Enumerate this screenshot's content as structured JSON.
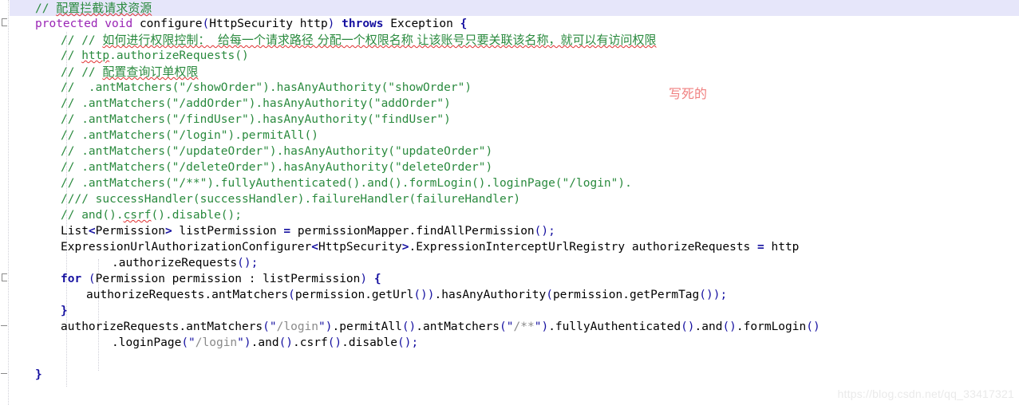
{
  "app": {
    "kind": "code-editor",
    "language": "Java",
    "theme": "light"
  },
  "colors": {
    "background": "#ffffff",
    "comment": "#2a8a3e",
    "keyword_purple": "#9a25b5",
    "keyword_blue": "#1510a0",
    "string": "#8a8a8a",
    "punctuation": "#1510a0",
    "current_line_highlight": "#e6e6fa",
    "spellcheck_squiggle": "#e03030",
    "annotation_red": "#f08080",
    "watermark": "#eaeaea",
    "indent_guide": "#cfcfd8",
    "fold_marker": "#8a8a8a"
  },
  "gutter": {
    "fold_markers": [
      {
        "line": 2,
        "type": "fold-end-bracket"
      },
      {
        "line": 18,
        "type": "fold-end-bracket"
      },
      {
        "line": 21,
        "type": "dash"
      },
      {
        "line": 24,
        "type": "dash"
      }
    ]
  },
  "annotation": {
    "text": "写死的",
    "meaning": "hard-coded"
  },
  "watermark": {
    "text": "https://blog.csdn.net/qq_33417321"
  },
  "code": {
    "line_height_px": 20,
    "current_line": 1,
    "lines": [
      {
        "n": 1,
        "indent": 4,
        "tokens": [
          {
            "t": "// ",
            "c": "cm"
          },
          {
            "t": "配置拦截请求资源",
            "c": "cm sq cjk"
          }
        ]
      },
      {
        "n": 2,
        "indent": 4,
        "tokens": [
          {
            "t": "protected void ",
            "c": "kw"
          },
          {
            "t": "configure",
            "c": "id"
          },
          {
            "t": "(",
            "c": "pl"
          },
          {
            "t": "HttpSecurity http",
            "c": "id"
          },
          {
            "t": ")",
            "c": "pl"
          },
          {
            "t": " throws ",
            "c": "kwb"
          },
          {
            "t": "Exception ",
            "c": "id"
          },
          {
            "t": "{",
            "c": "pun"
          }
        ]
      },
      {
        "n": 3,
        "indent": 8,
        "tokens": [
          {
            "t": "// // ",
            "c": "cm"
          },
          {
            "t": "如何进行权限控制：  给每一个请求路径 分配一个权限名称 让该账号只要关联该名称，就可以有访问权限",
            "c": "cm sq cjk"
          }
        ]
      },
      {
        "n": 4,
        "indent": 8,
        "tokens": [
          {
            "t": "// ",
            "c": "cm"
          },
          {
            "t": "http",
            "c": "cm sq"
          },
          {
            "t": ".authorizeRequests()",
            "c": "cm"
          }
        ]
      },
      {
        "n": 5,
        "indent": 8,
        "tokens": [
          {
            "t": "// // ",
            "c": "cm"
          },
          {
            "t": "配置查询订单权限",
            "c": "cm sq cjk"
          }
        ]
      },
      {
        "n": 6,
        "indent": 8,
        "tokens": [
          {
            "t": "//  .antMatchers(\"/showOrder\").hasAnyAuthority(\"showOrder\")",
            "c": "cm"
          }
        ]
      },
      {
        "n": 7,
        "indent": 8,
        "tokens": [
          {
            "t": "// .antMatchers(\"/addOrder\").hasAnyAuthority(\"addOrder\")",
            "c": "cm"
          }
        ]
      },
      {
        "n": 8,
        "indent": 8,
        "tokens": [
          {
            "t": "// .antMatchers(\"/findUser\").hasAnyAuthority(\"findUser\")",
            "c": "cm"
          }
        ]
      },
      {
        "n": 9,
        "indent": 8,
        "tokens": [
          {
            "t": "// .antMatchers(\"/login\").permitAll()",
            "c": "cm"
          }
        ]
      },
      {
        "n": 10,
        "indent": 8,
        "tokens": [
          {
            "t": "// .antMatchers(\"/updateOrder\").hasAnyAuthority(\"updateOrder\")",
            "c": "cm"
          }
        ]
      },
      {
        "n": 11,
        "indent": 8,
        "tokens": [
          {
            "t": "// .antMatchers(\"/deleteOrder\").hasAnyAuthority(\"deleteOrder\")",
            "c": "cm"
          }
        ]
      },
      {
        "n": 12,
        "indent": 8,
        "tokens": [
          {
            "t": "// .antMatchers(\"/**\").fullyAuthenticated().and().formLogin().loginPage(\"/login\").",
            "c": "cm"
          }
        ]
      },
      {
        "n": 13,
        "indent": 8,
        "tokens": [
          {
            "t": "//// successHandler(successHandler).failureHandler(failureHandler)",
            "c": "cm"
          }
        ]
      },
      {
        "n": 14,
        "indent": 8,
        "tokens": [
          {
            "t": "// and().",
            "c": "cm"
          },
          {
            "t": "csrf",
            "c": "cm sq"
          },
          {
            "t": "().disable();",
            "c": "cm"
          }
        ]
      },
      {
        "n": 15,
        "indent": 8,
        "tokens": [
          {
            "t": "List",
            "c": "id"
          },
          {
            "t": "<",
            "c": "op"
          },
          {
            "t": "Permission",
            "c": "id"
          },
          {
            "t": ">",
            "c": "op"
          },
          {
            "t": " listPermission ",
            "c": "id"
          },
          {
            "t": "=",
            "c": "op"
          },
          {
            "t": " permissionMapper.findAllPermission",
            "c": "id"
          },
          {
            "t": "()",
            "c": "pl"
          },
          {
            "t": ";",
            "c": "pl"
          }
        ]
      },
      {
        "n": 16,
        "indent": 8,
        "tokens": [
          {
            "t": "ExpressionUrlAuthorizationConfigurer",
            "c": "id"
          },
          {
            "t": "<",
            "c": "op"
          },
          {
            "t": "HttpSecurity",
            "c": "id"
          },
          {
            "t": ">",
            "c": "op"
          },
          {
            "t": ".ExpressionInterceptUrlRegistry authorizeRequests ",
            "c": "id"
          },
          {
            "t": "=",
            "c": "op"
          },
          {
            "t": " http",
            "c": "id"
          }
        ]
      },
      {
        "n": 17,
        "indent": 16,
        "tokens": [
          {
            "t": ".authorizeRequests",
            "c": "id"
          },
          {
            "t": "()",
            "c": "pl"
          },
          {
            "t": ";",
            "c": "pl"
          }
        ]
      },
      {
        "n": 18,
        "indent": 8,
        "tokens": [
          {
            "t": "for ",
            "c": "kwb"
          },
          {
            "t": "(",
            "c": "pl"
          },
          {
            "t": "Permission permission : listPermission",
            "c": "id"
          },
          {
            "t": ")",
            "c": "pl"
          },
          {
            "t": " ",
            "c": "id"
          },
          {
            "t": "{",
            "c": "pun"
          }
        ]
      },
      {
        "n": 19,
        "indent": 12,
        "tokens": [
          {
            "t": "authorizeRequests.antMatchers",
            "c": "id"
          },
          {
            "t": "(",
            "c": "pl"
          },
          {
            "t": "permission.getUrl",
            "c": "id"
          },
          {
            "t": "())",
            "c": "pl"
          },
          {
            "t": ".hasAnyAuthority",
            "c": "id"
          },
          {
            "t": "(",
            "c": "pl"
          },
          {
            "t": "permission.getPermTag",
            "c": "id"
          },
          {
            "t": "())",
            "c": "pl"
          },
          {
            "t": ";",
            "c": "pl"
          }
        ]
      },
      {
        "n": 20,
        "indent": 8,
        "tokens": [
          {
            "t": "}",
            "c": "pun"
          }
        ]
      },
      {
        "n": 21,
        "indent": 8,
        "tokens": [
          {
            "t": "authorizeRequests.antMatchers",
            "c": "id"
          },
          {
            "t": "(",
            "c": "pl"
          },
          {
            "t": "\"",
            "c": "strq"
          },
          {
            "t": "/login",
            "c": "str"
          },
          {
            "t": "\"",
            "c": "strq"
          },
          {
            "t": ")",
            "c": "pl"
          },
          {
            "t": ".permitAll",
            "c": "id"
          },
          {
            "t": "()",
            "c": "pl"
          },
          {
            "t": ".antMatchers",
            "c": "id"
          },
          {
            "t": "(",
            "c": "pl"
          },
          {
            "t": "\"",
            "c": "strq"
          },
          {
            "t": "/**",
            "c": "str"
          },
          {
            "t": "\"",
            "c": "strq"
          },
          {
            "t": ")",
            "c": "pl"
          },
          {
            "t": ".fullyAuthenticated",
            "c": "id"
          },
          {
            "t": "()",
            "c": "pl"
          },
          {
            "t": ".and",
            "c": "id"
          },
          {
            "t": "()",
            "c": "pl"
          },
          {
            "t": ".formLogin",
            "c": "id"
          },
          {
            "t": "()",
            "c": "pl"
          }
        ]
      },
      {
        "n": 22,
        "indent": 16,
        "tokens": [
          {
            "t": ".loginPage",
            "c": "id"
          },
          {
            "t": "(",
            "c": "pl"
          },
          {
            "t": "\"",
            "c": "strq"
          },
          {
            "t": "/login",
            "c": "str"
          },
          {
            "t": "\"",
            "c": "strq"
          },
          {
            "t": ")",
            "c": "pl"
          },
          {
            "t": ".and",
            "c": "id"
          },
          {
            "t": "()",
            "c": "pl"
          },
          {
            "t": ".csrf",
            "c": "id"
          },
          {
            "t": "()",
            "c": "pl"
          },
          {
            "t": ".disable",
            "c": "id"
          },
          {
            "t": "()",
            "c": "pl"
          },
          {
            "t": ";",
            "c": "pl"
          }
        ]
      },
      {
        "n": 23,
        "indent": 0,
        "tokens": []
      },
      {
        "n": 24,
        "indent": 4,
        "tokens": [
          {
            "t": "}",
            "c": "pun"
          }
        ]
      }
    ]
  }
}
